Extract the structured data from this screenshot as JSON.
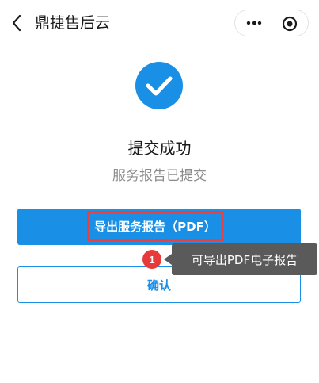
{
  "header": {
    "title": "鼎捷售后云",
    "back_icon": "back-arrow-icon",
    "more_icon": "more-dots-icon",
    "close_icon": "target-close-icon"
  },
  "result": {
    "icon": "check-circle-icon",
    "title": "提交成功",
    "subtitle": "服务报告已提交"
  },
  "actions": {
    "export_label": "导出服务报告（PDF）",
    "confirm_label": "确认"
  },
  "annotation": {
    "step": "1",
    "text": "可导出PDF电子报告"
  },
  "colors": {
    "primary": "#1a8fe6",
    "highlight": "#e84040",
    "badge": "#e83a3a",
    "tooltip_bg": "#5a5a5a"
  }
}
